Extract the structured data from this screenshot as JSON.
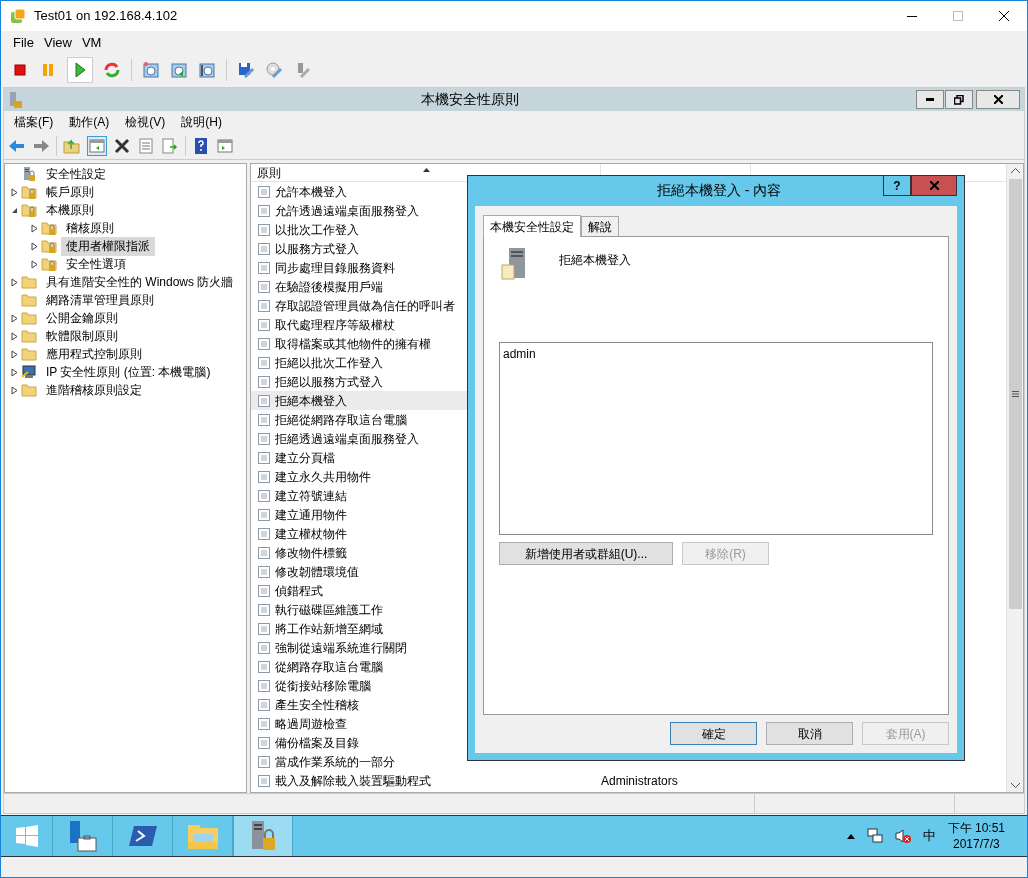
{
  "window": {
    "title": "Test01 on 192.168.4.102"
  },
  "menu": [
    "File",
    "View",
    "VM"
  ],
  "mmc": {
    "title": "本機安全性原則",
    "menu": [
      "檔案(F)",
      "動作(A)",
      "檢視(V)",
      "說明(H)"
    ],
    "tree": [
      {
        "label": "安全性設定",
        "kind": "root",
        "selected": false,
        "children": [
          {
            "label": "帳戶原則",
            "kind": "locked",
            "expanded": false,
            "selected": false
          },
          {
            "label": "本機原則",
            "kind": "locked",
            "expanded": true,
            "selected": false,
            "children": [
              {
                "label": "稽核原則",
                "kind": "locked",
                "expanded": false,
                "selected": false
              },
              {
                "label": "使用者權限指派",
                "kind": "locked",
                "expanded": false,
                "selected": true
              },
              {
                "label": "安全性選項",
                "kind": "locked",
                "expanded": false,
                "selected": false
              }
            ]
          },
          {
            "label": "具有進階安全性的 Windows 防火牆",
            "kind": "folder",
            "expanded": false,
            "selected": false
          },
          {
            "label": "網路清單管理員原則",
            "kind": "leaf",
            "selected": false
          },
          {
            "label": "公開金鑰原則",
            "kind": "folder",
            "expanded": false,
            "selected": false
          },
          {
            "label": "軟體限制原則",
            "kind": "folder",
            "expanded": false,
            "selected": false
          },
          {
            "label": "應用程式控制原則",
            "kind": "folder",
            "expanded": false,
            "selected": false
          },
          {
            "label": "IP 安全性原則 (位置: 本機電腦)",
            "kind": "ip",
            "expanded": false,
            "selected": false
          },
          {
            "label": "進階稽核原則設定",
            "kind": "folder",
            "expanded": false,
            "selected": false
          }
        ]
      }
    ],
    "list": {
      "columns": [
        "原則"
      ],
      "rows": [
        {
          "name": "允許本機登入",
          "selected": false
        },
        {
          "name": "允許透過遠端桌面服務登入",
          "selected": false
        },
        {
          "name": "以批次工作登入",
          "selected": false
        },
        {
          "name": "以服務方式登入",
          "selected": false
        },
        {
          "name": "同步處理目錄服務資料",
          "selected": false
        },
        {
          "name": "在驗證後模擬用戶端",
          "selected": false
        },
        {
          "name": "存取認證管理員做為信任的呼叫者",
          "selected": false
        },
        {
          "name": "取代處理程序等級權杖",
          "selected": false
        },
        {
          "name": "取得檔案或其他物件的擁有權",
          "selected": false
        },
        {
          "name": "拒絕以批次工作登入",
          "selected": false
        },
        {
          "name": "拒絕以服務方式登入",
          "selected": false
        },
        {
          "name": "拒絕本機登入",
          "selected": true
        },
        {
          "name": "拒絕從網路存取這台電腦",
          "selected": false
        },
        {
          "name": "拒絕透過遠端桌面服務登入",
          "selected": false
        },
        {
          "name": "建立分頁檔",
          "selected": false
        },
        {
          "name": "建立永久共用物件",
          "selected": false
        },
        {
          "name": "建立符號連結",
          "selected": false
        },
        {
          "name": "建立通用物件",
          "selected": false
        },
        {
          "name": "建立權杖物件",
          "selected": false
        },
        {
          "name": "修改物件標籤",
          "selected": false
        },
        {
          "name": "修改韌體環境值",
          "selected": false
        },
        {
          "name": "偵錯程式",
          "selected": false
        },
        {
          "name": "執行磁碟區維護工作",
          "selected": false
        },
        {
          "name": "將工作站新增至網域",
          "selected": false
        },
        {
          "name": "強制從遠端系統進行關閉",
          "selected": false
        },
        {
          "name": "從網路存取這台電腦",
          "selected": false
        },
        {
          "name": "從銜接站移除電腦",
          "selected": false
        },
        {
          "name": "產生安全性稽核",
          "selected": false
        },
        {
          "name": "略過周遊檢查",
          "selected": false
        },
        {
          "name": "備份檔案及目錄",
          "selected": false
        },
        {
          "name": "當成作業系統的一部分",
          "selected": false
        },
        {
          "name": "載入及解除載入裝置驅動程式",
          "value": "Administrators",
          "selected": false
        }
      ]
    }
  },
  "dialog": {
    "title": "拒絕本機登入 - 內容",
    "help": "?",
    "tabs": [
      {
        "label": "本機安全性設定",
        "selected": true
      },
      {
        "label": "解說",
        "selected": false
      }
    ],
    "policy_name": "拒絕本機登入",
    "members": [
      "admin"
    ],
    "member_buttons": [
      {
        "label": "新增使用者或群組(U)...",
        "disabled": false
      },
      {
        "label": "移除(R)",
        "disabled": true
      }
    ],
    "buttons": [
      {
        "label": "確定",
        "disabled": false,
        "default": true
      },
      {
        "label": "取消",
        "disabled": false,
        "default": false
      },
      {
        "label": "套用(A)",
        "disabled": true,
        "default": false
      }
    ]
  },
  "taskbar": {
    "items": [
      {
        "kind": "server-manager",
        "active": false
      },
      {
        "kind": "powershell",
        "active": false
      },
      {
        "kind": "explorer",
        "active": false
      },
      {
        "kind": "security-policy",
        "active": true
      }
    ],
    "ime": "中",
    "time": "下午 10:51",
    "date": "2017/7/3"
  }
}
